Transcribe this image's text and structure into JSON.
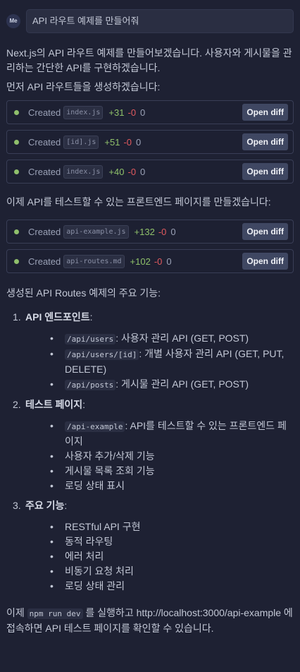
{
  "user": {
    "avatar": "Me",
    "message": "API 라우트 예제를 만들어줘"
  },
  "intro": [
    "Next.js의 API 라우트 예제를 만들어보겠습니다. 사용자와 게시물을 관리하는 간단한 API를 구현하겠습니다.",
    "먼저 API 라우트들을 생성하겠습니다:"
  ],
  "created_label": "Created",
  "open_diff_label": "Open diff",
  "files_group1": [
    {
      "name": "index.js",
      "added": "+31",
      "removed": "-0",
      "changed": "0"
    },
    {
      "name": "[id].js",
      "added": "+51",
      "removed": "-0",
      "changed": "0"
    },
    {
      "name": "index.js",
      "added": "+40",
      "removed": "-0",
      "changed": "0"
    }
  ],
  "middle_text": "이제 API를 테스트할 수 있는 프론트엔드 페이지를 만들겠습니다:",
  "files_group2": [
    {
      "name": "api-example.js",
      "added": "+132",
      "removed": "-0",
      "changed": "0"
    },
    {
      "name": "api-routes.md",
      "added": "+102",
      "removed": "-0",
      "changed": "0"
    }
  ],
  "features_heading": "생성된 API Routes 예제의 주요 기능:",
  "sections": [
    {
      "num": "1.",
      "title": "API 엔드포인트",
      "suffix": ":",
      "items": [
        {
          "code": "/api/users",
          "text": ": 사용자 관리 API (GET, POST)"
        },
        {
          "code": "/api/users/[id]",
          "text": ": 개별 사용자 관리 API (GET, PUT, DELETE)"
        },
        {
          "code": "/api/posts",
          "text": ": 게시물 관리 API (GET, POST)"
        }
      ]
    },
    {
      "num": "2.",
      "title": "테스트 페이지",
      "suffix": ":",
      "items": [
        {
          "code": "/api-example",
          "text": ": API를 테스트할 수 있는 프론트엔드 페이지"
        },
        {
          "code": "",
          "text": "사용자 추가/삭제 기능"
        },
        {
          "code": "",
          "text": "게시물 목록 조회 기능"
        },
        {
          "code": "",
          "text": "로딩 상태 표시"
        }
      ]
    },
    {
      "num": "3.",
      "title": "주요 기능",
      "suffix": ":",
      "items": [
        {
          "code": "",
          "text": "RESTful API 구현"
        },
        {
          "code": "",
          "text": "동적 라우팅"
        },
        {
          "code": "",
          "text": "에러 처리"
        },
        {
          "code": "",
          "text": "비동기 요청 처리"
        },
        {
          "code": "",
          "text": "로딩 상태 관리"
        }
      ]
    }
  ],
  "footer": {
    "before": "이제 ",
    "code": "npm run dev",
    "after": " 를 실행하고 http://localhost:3000/api-example 에 접속하면 API 테스트 페이지를 확인할 수 있습니다."
  }
}
